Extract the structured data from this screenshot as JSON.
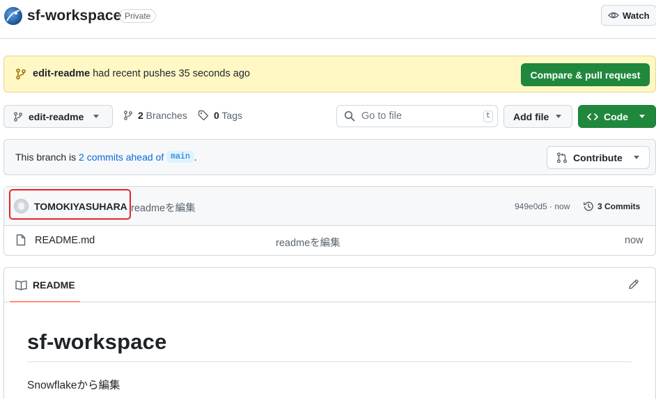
{
  "header": {
    "repo_name": "sf-workspace",
    "visibility_badge": "Private",
    "watch_label": "Watch"
  },
  "flash": {
    "branch": "edit-readme",
    "message": " had recent pushes 35 seconds ago",
    "button_label": "Compare & pull request"
  },
  "toolbar": {
    "branch_name": "edit-readme",
    "branches_count": "2",
    "branches_label": " Branches",
    "tags_count": "0",
    "tags_label": " Tags",
    "search_placeholder": "Go to file",
    "search_shortcut": "t",
    "add_file_label": "Add file",
    "code_label": "Code"
  },
  "ahead": {
    "prefix": "This branch is ",
    "link": "2 commits ahead of",
    "base_branch": "main",
    "suffix": ".",
    "contribute_label": "Contribute"
  },
  "latest_commit": {
    "author": "TOMOKIYASUHARA",
    "message": "readmeを編集",
    "hash_time": "949e0d5 · now",
    "commits_label": "3 Commits"
  },
  "files": [
    {
      "name": "README.md",
      "message": "readmeを編集",
      "time": "now"
    }
  ],
  "readme": {
    "tab_label": "README",
    "heading": "sf-workspace",
    "paragraph": "Snowflakeから編集"
  },
  "colors": {
    "primary_green": "#1f883d",
    "link_blue": "#0969da",
    "flash_bg": "#fff8c5",
    "highlight_red": "#e5232b",
    "tab_underline": "#fd8c73"
  },
  "icons": [
    "repo-avatar-icon",
    "eye-icon",
    "git-branch-icon",
    "tag-icon",
    "search-icon",
    "code-icon",
    "pull-request-icon",
    "history-icon",
    "file-icon",
    "book-icon",
    "pencil-icon"
  ]
}
